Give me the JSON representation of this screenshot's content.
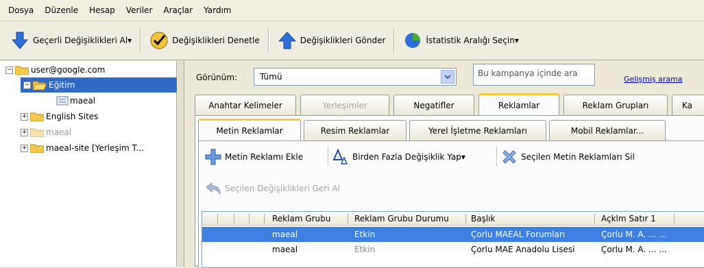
{
  "menu": [
    "Dosya",
    "Düzenle",
    "Hesap",
    "Veriler",
    "Araçlar",
    "Yardım"
  ],
  "toolbar": {
    "get_changes": "Geçerli Değişiklikleri Al▾",
    "check_changes": "Değişiklikleri Denetle",
    "post_changes": "Değişiklikleri Gönder",
    "stats_range": "İstatistik Aralığı Seçin▾"
  },
  "tree": {
    "account": "user@google.com",
    "campaign_selected": "Eğitim",
    "adgroup": "maeal",
    "campaign2": "English Sites",
    "campaign3": "maeal",
    "campaign4": "maeal-site [Yerleşim T..."
  },
  "view": {
    "label": "Görünüm:",
    "value": "Tümü",
    "search_placeholder": "Bu kampanya içinde ara",
    "advanced_search": "Gelişmiş arama"
  },
  "tabs": [
    "Anahtar Kelimeler",
    "Yerleşimler",
    "Negatifler",
    "Reklamlar",
    "Reklam Grupları",
    "Ka"
  ],
  "subtabs": [
    "Metin Reklamlar",
    "Resim Reklamlar",
    "Yerel İşletme Reklamları",
    "Mobil Reklamlar..."
  ],
  "actions": {
    "add_text_ad": "Metin Reklamı Ekle",
    "bulk_edit": "Birden Fazla Değişiklik Yap▾",
    "delete_selected": "Seçilen Metin Reklamları Sil",
    "undo_selected": "Seçilen Değişiklikleri Geri Al"
  },
  "grid": {
    "columns": [
      "Reklam Grubu",
      "Reklam Grubu Durumu",
      "Başlık",
      "Açklm Satır 1"
    ],
    "rows": [
      {
        "group": "maeal",
        "status": "Etkin",
        "title": "Çorlu MAEAL Forumları",
        "desc": "Çorlu M. A. ... ..."
      },
      {
        "group": "maeal",
        "status": "Etkin",
        "title": "Çorlu MAE Anadolu Lisesi",
        "desc": "Çorlu M. A. ... ..."
      }
    ]
  },
  "colors": {
    "selection": "#316ac5",
    "grid_selection": "#3d80df",
    "tab_highlight": "#ffc83c"
  }
}
